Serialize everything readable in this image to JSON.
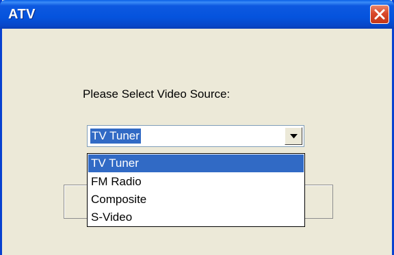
{
  "window": {
    "title": "ATV",
    "close_icon": "close-icon"
  },
  "dialog": {
    "prompt": "Please Select Video Source:",
    "combo_value": "TV Tuner",
    "dropdown_options": [
      "TV Tuner",
      "FM Radio",
      "Composite",
      "S-Video"
    ],
    "selected_option": "TV Tuner"
  },
  "colors": {
    "title_bar": "#0553dd",
    "selection": "#316ac5",
    "dialog_bg": "#ece9d8",
    "close_button": "#d9482b"
  }
}
